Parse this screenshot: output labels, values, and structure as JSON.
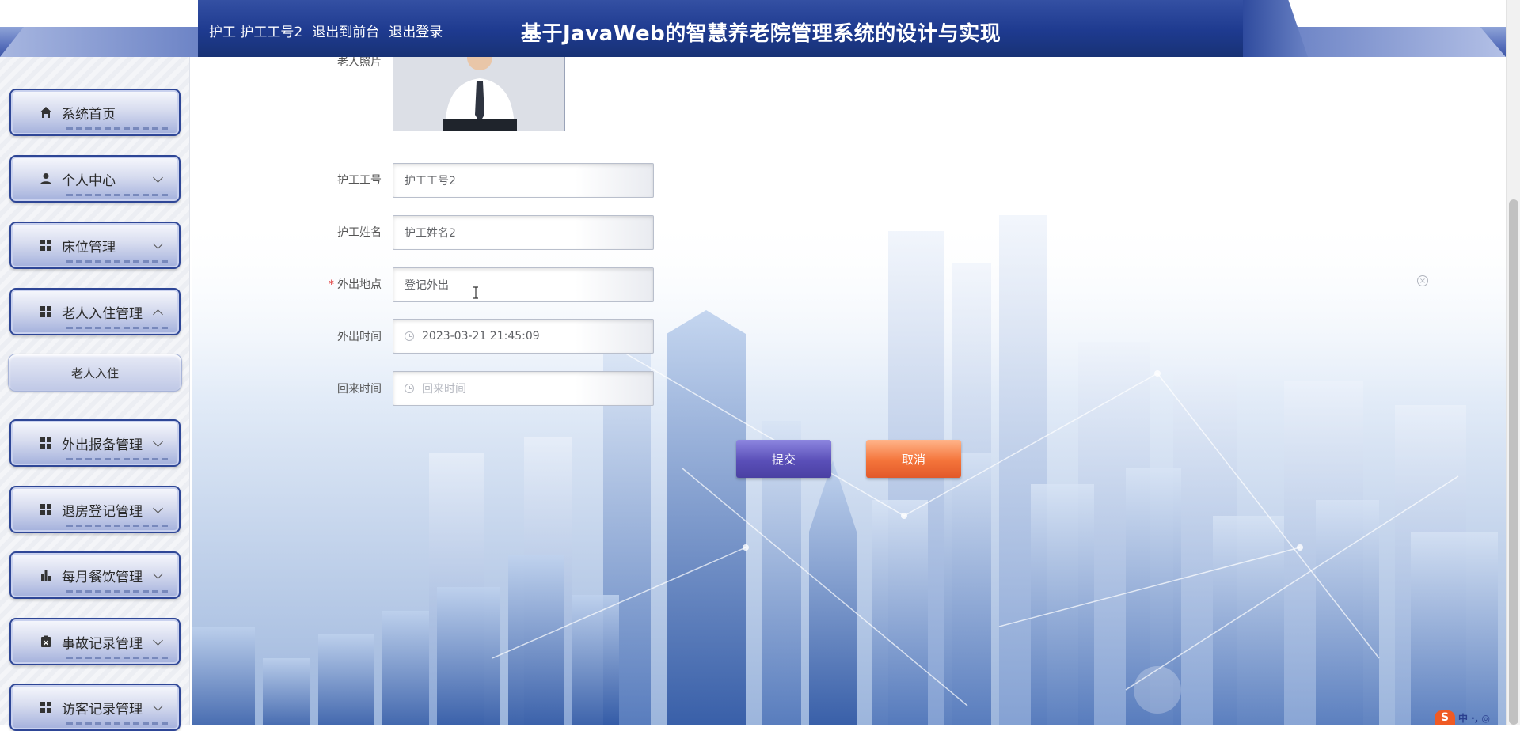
{
  "header": {
    "role": "护工",
    "username": "护工工号2",
    "back_to_front": "退出到前台",
    "logout": "退出登录",
    "title": "基于JavaWeb的智慧养老院管理系统的设计与实现"
  },
  "sidebar": {
    "items": [
      {
        "label": "系统首页",
        "icon": "home-icon"
      },
      {
        "label": "个人中心",
        "icon": "person-icon"
      },
      {
        "label": "床位管理",
        "icon": "grid-icon"
      },
      {
        "label": "老人入住管理",
        "icon": "grid-icon"
      },
      {
        "label": "外出报备管理",
        "icon": "grid-icon"
      },
      {
        "label": "退房登记管理",
        "icon": "grid-icon"
      },
      {
        "label": "每月餐饮管理",
        "icon": "bar-chart-icon"
      },
      {
        "label": "事故记录管理",
        "icon": "clipboard-icon"
      },
      {
        "label": "访客记录管理",
        "icon": "grid-icon"
      }
    ],
    "submenu": {
      "label": "老人入住"
    }
  },
  "form": {
    "photo_label": "老人照片",
    "nurse_id_label": "护工工号",
    "nurse_id_value": "护工工号2",
    "nurse_name_label": "护工姓名",
    "nurse_name_value": "护工姓名2",
    "place_label": "外出地点",
    "place_value": "登记外出",
    "out_time_label": "外出时间",
    "out_time_value": "2023-03-21 21:45:09",
    "return_time_label": "回来时间",
    "return_time_placeholder": "回来时间",
    "submit_label": "提交",
    "cancel_label": "取消"
  },
  "corner_badge": {
    "logo": "S",
    "text": "中 ·, ◎"
  }
}
